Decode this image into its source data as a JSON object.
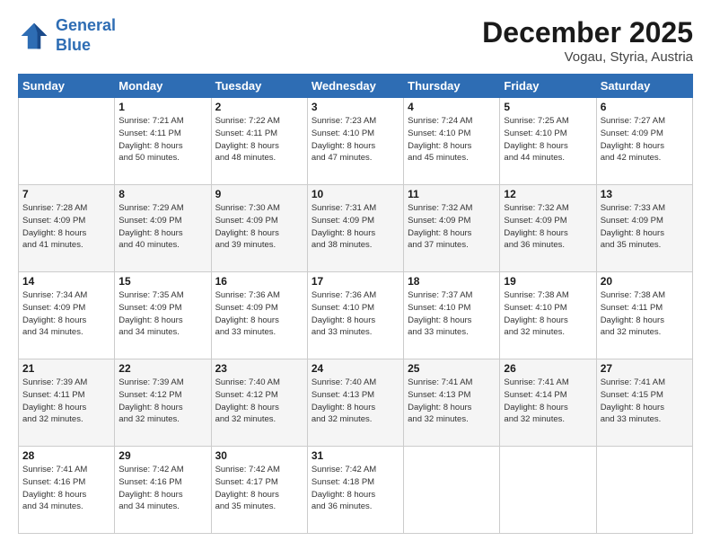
{
  "logo": {
    "line1": "General",
    "line2": "Blue"
  },
  "title": "December 2025",
  "location": "Vogau, Styria, Austria",
  "days_header": [
    "Sunday",
    "Monday",
    "Tuesday",
    "Wednesday",
    "Thursday",
    "Friday",
    "Saturday"
  ],
  "weeks": [
    [
      {
        "num": "",
        "info": ""
      },
      {
        "num": "1",
        "info": "Sunrise: 7:21 AM\nSunset: 4:11 PM\nDaylight: 8 hours\nand 50 minutes."
      },
      {
        "num": "2",
        "info": "Sunrise: 7:22 AM\nSunset: 4:11 PM\nDaylight: 8 hours\nand 48 minutes."
      },
      {
        "num": "3",
        "info": "Sunrise: 7:23 AM\nSunset: 4:10 PM\nDaylight: 8 hours\nand 47 minutes."
      },
      {
        "num": "4",
        "info": "Sunrise: 7:24 AM\nSunset: 4:10 PM\nDaylight: 8 hours\nand 45 minutes."
      },
      {
        "num": "5",
        "info": "Sunrise: 7:25 AM\nSunset: 4:10 PM\nDaylight: 8 hours\nand 44 minutes."
      },
      {
        "num": "6",
        "info": "Sunrise: 7:27 AM\nSunset: 4:09 PM\nDaylight: 8 hours\nand 42 minutes."
      }
    ],
    [
      {
        "num": "7",
        "info": "Sunrise: 7:28 AM\nSunset: 4:09 PM\nDaylight: 8 hours\nand 41 minutes."
      },
      {
        "num": "8",
        "info": "Sunrise: 7:29 AM\nSunset: 4:09 PM\nDaylight: 8 hours\nand 40 minutes."
      },
      {
        "num": "9",
        "info": "Sunrise: 7:30 AM\nSunset: 4:09 PM\nDaylight: 8 hours\nand 39 minutes."
      },
      {
        "num": "10",
        "info": "Sunrise: 7:31 AM\nSunset: 4:09 PM\nDaylight: 8 hours\nand 38 minutes."
      },
      {
        "num": "11",
        "info": "Sunrise: 7:32 AM\nSunset: 4:09 PM\nDaylight: 8 hours\nand 37 minutes."
      },
      {
        "num": "12",
        "info": "Sunrise: 7:32 AM\nSunset: 4:09 PM\nDaylight: 8 hours\nand 36 minutes."
      },
      {
        "num": "13",
        "info": "Sunrise: 7:33 AM\nSunset: 4:09 PM\nDaylight: 8 hours\nand 35 minutes."
      }
    ],
    [
      {
        "num": "14",
        "info": "Sunrise: 7:34 AM\nSunset: 4:09 PM\nDaylight: 8 hours\nand 34 minutes."
      },
      {
        "num": "15",
        "info": "Sunrise: 7:35 AM\nSunset: 4:09 PM\nDaylight: 8 hours\nand 34 minutes."
      },
      {
        "num": "16",
        "info": "Sunrise: 7:36 AM\nSunset: 4:09 PM\nDaylight: 8 hours\nand 33 minutes."
      },
      {
        "num": "17",
        "info": "Sunrise: 7:36 AM\nSunset: 4:10 PM\nDaylight: 8 hours\nand 33 minutes."
      },
      {
        "num": "18",
        "info": "Sunrise: 7:37 AM\nSunset: 4:10 PM\nDaylight: 8 hours\nand 33 minutes."
      },
      {
        "num": "19",
        "info": "Sunrise: 7:38 AM\nSunset: 4:10 PM\nDaylight: 8 hours\nand 32 minutes."
      },
      {
        "num": "20",
        "info": "Sunrise: 7:38 AM\nSunset: 4:11 PM\nDaylight: 8 hours\nand 32 minutes."
      }
    ],
    [
      {
        "num": "21",
        "info": "Sunrise: 7:39 AM\nSunset: 4:11 PM\nDaylight: 8 hours\nand 32 minutes."
      },
      {
        "num": "22",
        "info": "Sunrise: 7:39 AM\nSunset: 4:12 PM\nDaylight: 8 hours\nand 32 minutes."
      },
      {
        "num": "23",
        "info": "Sunrise: 7:40 AM\nSunset: 4:12 PM\nDaylight: 8 hours\nand 32 minutes."
      },
      {
        "num": "24",
        "info": "Sunrise: 7:40 AM\nSunset: 4:13 PM\nDaylight: 8 hours\nand 32 minutes."
      },
      {
        "num": "25",
        "info": "Sunrise: 7:41 AM\nSunset: 4:13 PM\nDaylight: 8 hours\nand 32 minutes."
      },
      {
        "num": "26",
        "info": "Sunrise: 7:41 AM\nSunset: 4:14 PM\nDaylight: 8 hours\nand 32 minutes."
      },
      {
        "num": "27",
        "info": "Sunrise: 7:41 AM\nSunset: 4:15 PM\nDaylight: 8 hours\nand 33 minutes."
      }
    ],
    [
      {
        "num": "28",
        "info": "Sunrise: 7:41 AM\nSunset: 4:16 PM\nDaylight: 8 hours\nand 34 minutes."
      },
      {
        "num": "29",
        "info": "Sunrise: 7:42 AM\nSunset: 4:16 PM\nDaylight: 8 hours\nand 34 minutes."
      },
      {
        "num": "30",
        "info": "Sunrise: 7:42 AM\nSunset: 4:17 PM\nDaylight: 8 hours\nand 35 minutes."
      },
      {
        "num": "31",
        "info": "Sunrise: 7:42 AM\nSunset: 4:18 PM\nDaylight: 8 hours\nand 36 minutes."
      },
      {
        "num": "",
        "info": ""
      },
      {
        "num": "",
        "info": ""
      },
      {
        "num": "",
        "info": ""
      }
    ]
  ]
}
